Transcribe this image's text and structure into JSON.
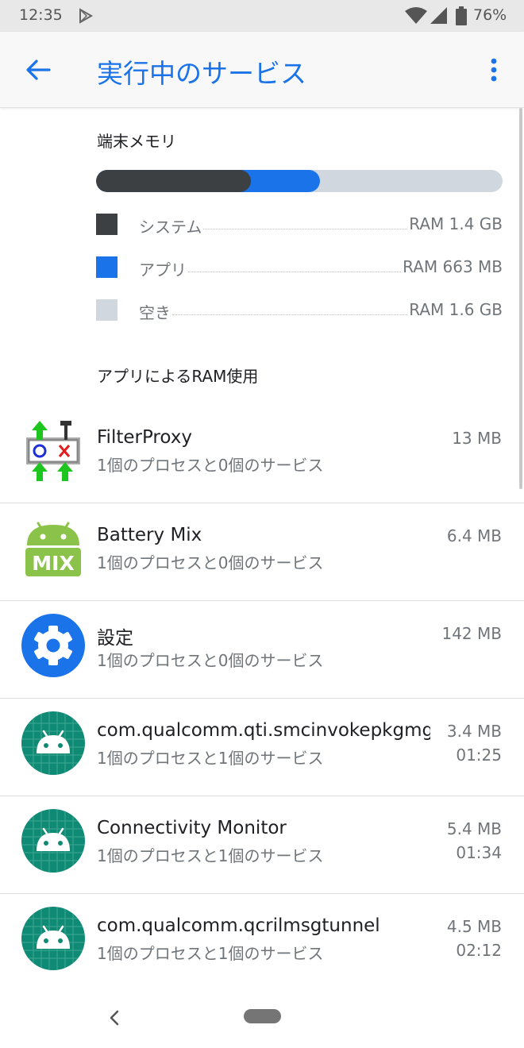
{
  "status_bar": {
    "time": "12:35",
    "battery": "76%"
  },
  "app_bar": {
    "title": "実行中のサービス"
  },
  "device_memory": {
    "label": "端末メモリ",
    "bar": {
      "system_fraction": 0.381,
      "apps_fraction": 0.17,
      "colors": {
        "system": "#3c4043",
        "apps": "#1a73e8",
        "free": "#d0d7de"
      }
    },
    "legend": [
      {
        "label": "システム",
        "value": "RAM 1.4 GB",
        "color": "#3c4043"
      },
      {
        "label": "アプリ",
        "value": "RAM 663 MB",
        "color": "#1a73e8"
      },
      {
        "label": "空き",
        "value": "RAM 1.6 GB",
        "color": "#d0d7de"
      }
    ]
  },
  "app_ram": {
    "label": "アプリによるRAM使用",
    "apps": [
      {
        "name": "FilterProxy",
        "detail": "1個のプロセスと0個のサービス",
        "size": "13 MB",
        "time": "",
        "icon": "filterproxy-icon"
      },
      {
        "name": "Battery Mix",
        "detail": "1個のプロセスと0個のサービス",
        "size": "6.4 MB",
        "time": "",
        "icon": "battery-mix-icon"
      },
      {
        "name": "設定",
        "detail": "1個のプロセスと0個のサービス",
        "size": "142 MB",
        "time": "",
        "icon": "settings-gear-icon"
      },
      {
        "name": "com.qualcomm.qti.smcinvokepkgmgr",
        "detail": "1個のプロセスと1個のサービス",
        "size": "3.4 MB",
        "time": "01:25",
        "icon": "android-icon"
      },
      {
        "name": "Connectivity Monitor",
        "detail": "1個のプロセスと1個のサービス",
        "size": "5.4 MB",
        "time": "01:34",
        "icon": "android-icon"
      },
      {
        "name": "com.qualcomm.qcrilmsgtunnel",
        "detail": "1個のプロセスと1個のサービス",
        "size": "4.5 MB",
        "time": "02:12",
        "icon": "android-icon"
      }
    ]
  },
  "colors": {
    "accent": "#1a73e8",
    "android_teal": "#0f8a74",
    "battery_mix_green": "#8bc34a"
  }
}
